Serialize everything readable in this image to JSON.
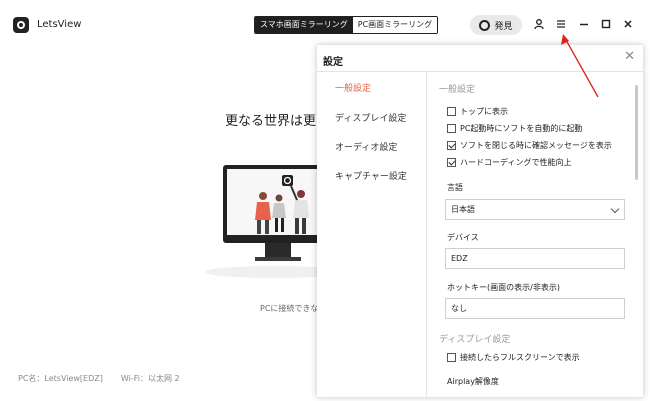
{
  "app": {
    "title": "LetsView",
    "mode_tabs": [
      "スマホ画面ミラーリング",
      "PC画面ミラーリング"
    ],
    "discover_label": "発見",
    "icons": [
      "user-icon",
      "menu-icon",
      "minimize-icon",
      "maximize-icon",
      "close-icon"
    ]
  },
  "main": {
    "hero_title": "更なる世界は更",
    "hero_sub": "PCに接続できな",
    "footer_pc": "PC名：LetsView[EDZ]",
    "footer_wifi": "Wi-Fi：以太网 2"
  },
  "settings": {
    "title": "設定",
    "nav": [
      "一般設定",
      "ディスプレイ設定",
      "オーディオ設定",
      "キャプチャー設定"
    ],
    "general": {
      "section_title": "一般設定",
      "options": [
        {
          "label": "トップに表示",
          "checked": false
        },
        {
          "label": "PC起動時にソフトを自動的に起動",
          "checked": false
        },
        {
          "label": "ソフトを閉じる時に確認メッセージを表示",
          "checked": true
        },
        {
          "label": "ハードコーディングで性能向上",
          "checked": true
        }
      ],
      "language_label": "言語",
      "language_value": "日本語",
      "device_label": "デバイス",
      "device_value": "EDZ",
      "hotkey_label": "ホットキー(画面の表示/非表示)",
      "hotkey_value": "なし"
    },
    "display": {
      "section_title": "ディスプレイ設定",
      "fullscreen_label": "接続したらフルスクリーンで表示",
      "fullscreen_checked": false,
      "airplay_label": "Airplay解像度"
    }
  },
  "colors": {
    "accent": "#e8614a",
    "annotation_arrow": "#e0221c"
  }
}
